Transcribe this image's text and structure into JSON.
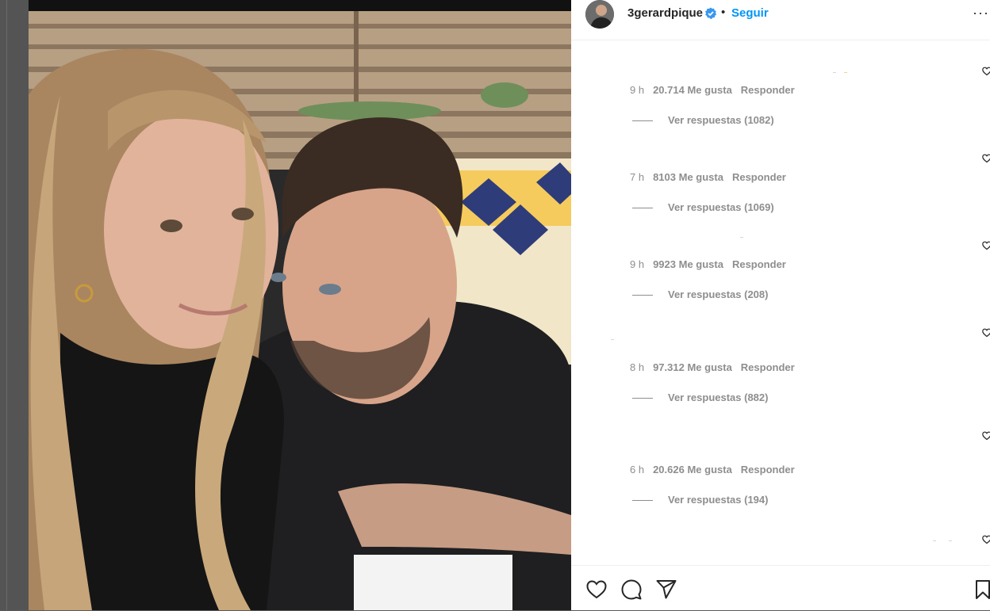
{
  "post": {
    "username": "3gerardpique",
    "separator": "•",
    "follow_label": "Seguir",
    "more_label": "···",
    "verified": true
  },
  "comments": [
    {
      "age": "9 h",
      "likes": "20.714 Me gusta",
      "reply_label": "Responder",
      "replies_label": "Ver respuestas (1082)"
    },
    {
      "age": "7 h",
      "likes": "8103 Me gusta",
      "reply_label": "Responder",
      "replies_label": "Ver respuestas (1069)"
    },
    {
      "age": "9 h",
      "likes": "9923 Me gusta",
      "reply_label": "Responder",
      "replies_label": "Ver respuestas (208)"
    },
    {
      "age": "8 h",
      "likes": "97.312 Me gusta",
      "reply_label": "Responder",
      "replies_label": "Ver respuestas (882)"
    },
    {
      "age": "6 h",
      "likes": "20.626 Me gusta",
      "reply_label": "Responder",
      "replies_label": "Ver respuestas (194)"
    }
  ],
  "icons": {
    "like": "heart-icon",
    "comment": "comment-bubble-icon",
    "share": "paper-plane-icon",
    "save": "bookmark-icon",
    "verified": "verified-badge-icon",
    "comment_like": "small-heart-icon"
  },
  "colors": {
    "accent": "#0095f6",
    "text": "#262626",
    "secondary": "#8e8e8e",
    "verified": "#3897f0"
  }
}
